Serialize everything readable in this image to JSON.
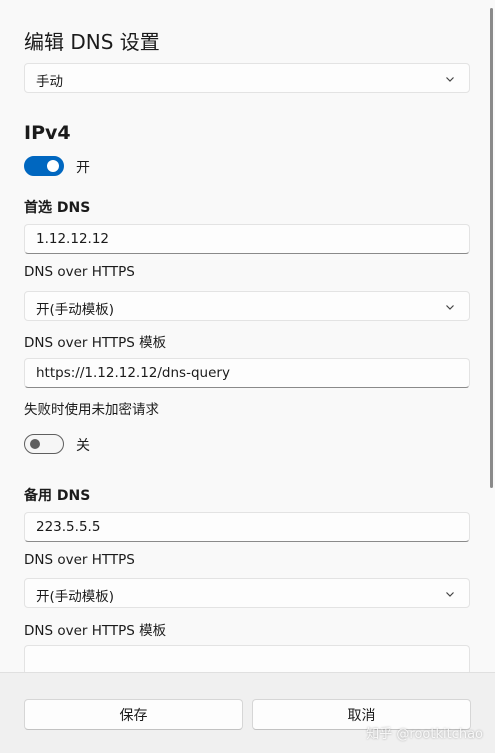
{
  "dialog": {
    "title": "编辑 DNS 设置",
    "mode_select": {
      "value": "手动"
    }
  },
  "ipv4": {
    "heading": "IPv4",
    "toggle": {
      "state": "on",
      "label": "开"
    },
    "preferred": {
      "label": "首选 DNS",
      "value": "1.12.12.12",
      "doh_label": "DNS over HTTPS",
      "doh_value": "开(手动模板)",
      "template_label": "DNS over HTTPS 模板",
      "template_value": "https://1.12.12.12/dns-query",
      "fallback_label": "失败时使用未加密请求",
      "fallback_toggle": {
        "state": "off",
        "label": "关"
      }
    },
    "alternate": {
      "label": "备用 DNS",
      "value": "223.5.5.5",
      "doh_label": "DNS over HTTPS",
      "doh_value": "开(手动模板)",
      "template_label": "DNS over HTTPS 模板"
    }
  },
  "footer": {
    "save_label": "保存",
    "cancel_label": "取消",
    "watermark": "知乎 @rootkitchao"
  },
  "colors": {
    "accent": "#0067c0",
    "background": "#f9f9f9",
    "footer": "#f0f0f0"
  },
  "icons": {
    "dropdown": "chevron-down-icon"
  }
}
